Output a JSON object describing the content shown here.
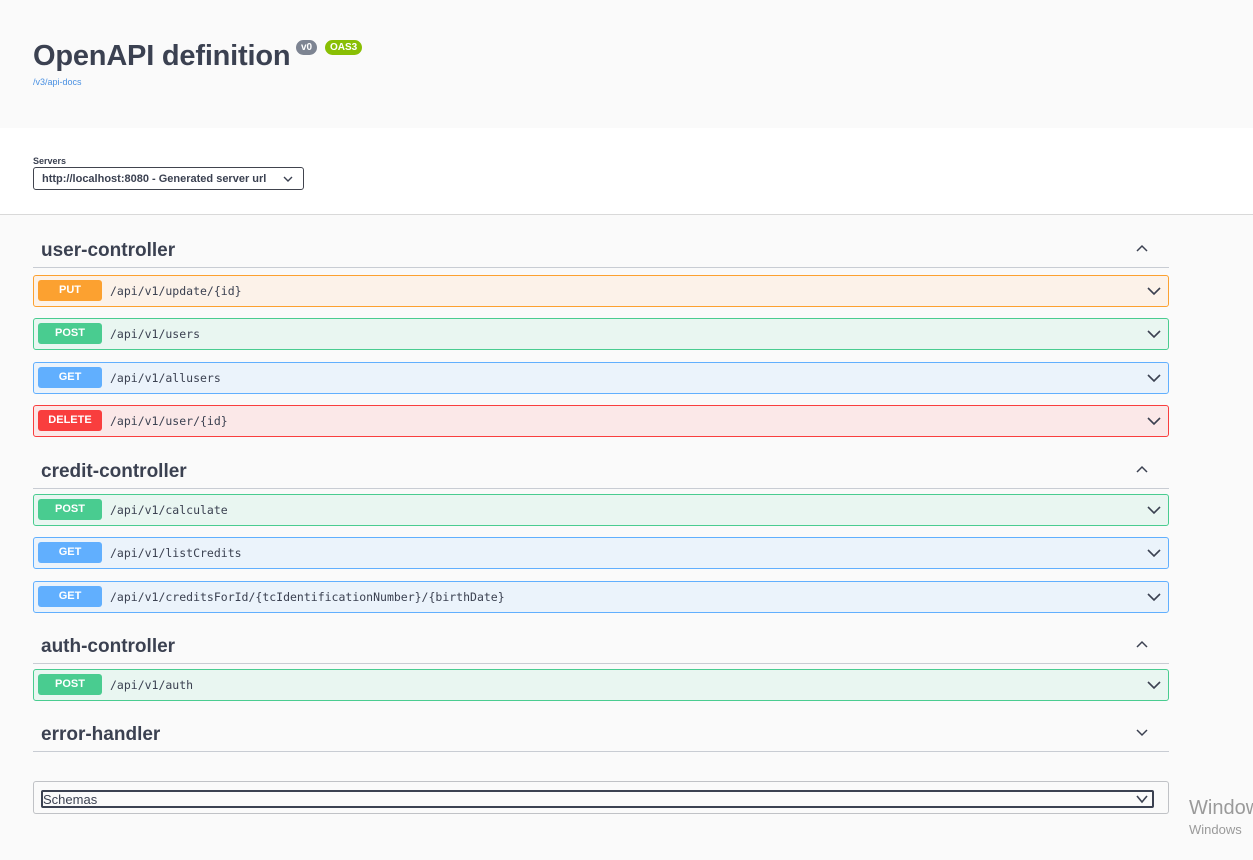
{
  "info": {
    "title": "OpenAPI definition",
    "version_badge": "v0",
    "oas_badge": "OAS3",
    "api_docs_link": "/v3/api-docs"
  },
  "servers": {
    "label": "Servers",
    "selected": "http://localhost:8080 - Generated server url"
  },
  "tags": [
    {
      "name": "user-controller",
      "expanded": true,
      "operations": [
        {
          "method": "PUT",
          "path": "/api/v1/update/{id}"
        },
        {
          "method": "POST",
          "path": "/api/v1/users"
        },
        {
          "method": "GET",
          "path": "/api/v1/allusers"
        },
        {
          "method": "DELETE",
          "path": "/api/v1/user/{id}"
        }
      ]
    },
    {
      "name": "credit-controller",
      "expanded": true,
      "operations": [
        {
          "method": "POST",
          "path": "/api/v1/calculate"
        },
        {
          "method": "GET",
          "path": "/api/v1/listCredits"
        },
        {
          "method": "GET",
          "path": "/api/v1/creditsForId/{tcIdentificationNumber}/{birthDate}"
        }
      ]
    },
    {
      "name": "auth-controller",
      "expanded": true,
      "operations": [
        {
          "method": "POST",
          "path": "/api/v1/auth"
        }
      ]
    },
    {
      "name": "error-handler",
      "expanded": false,
      "operations": []
    }
  ],
  "schemas": {
    "label": "Schemas"
  },
  "watermark": {
    "line1": "Window",
    "line2": "Windows"
  },
  "colors": {
    "put": "#fca130",
    "post": "#49cc90",
    "get": "#61affe",
    "delete": "#f93e3e",
    "link": "#4990e2",
    "oas_badge": "#89bf04"
  }
}
